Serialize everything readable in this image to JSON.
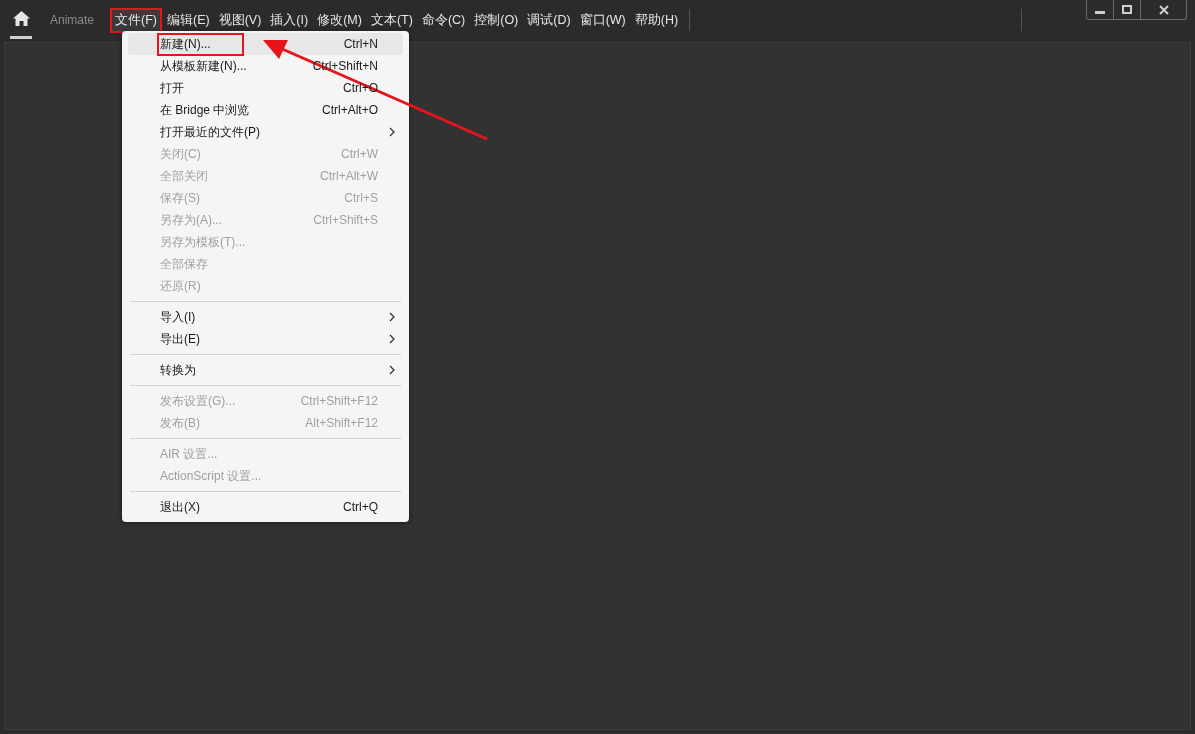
{
  "app": {
    "name": "Animate",
    "home_selected": true
  },
  "menu_bar": [
    {
      "label": "文件(F)",
      "selected": true,
      "marked": true
    },
    {
      "label": "编辑(E)",
      "selected": false,
      "marked": false
    },
    {
      "label": "视图(V)",
      "selected": false,
      "marked": false
    },
    {
      "label": "插入(I)",
      "selected": false,
      "marked": false
    },
    {
      "label": "修改(M)",
      "selected": false,
      "marked": false
    },
    {
      "label": "文本(T)",
      "selected": false,
      "marked": false
    },
    {
      "label": "命令(C)",
      "selected": false,
      "marked": false
    },
    {
      "label": "控制(O)",
      "selected": false,
      "marked": false
    },
    {
      "label": "调试(D)",
      "selected": false,
      "marked": false
    },
    {
      "label": "窗口(W)",
      "selected": false,
      "marked": false
    },
    {
      "label": "帮助(H)",
      "selected": false,
      "marked": false
    }
  ],
  "file_menu": [
    {
      "kind": "item",
      "label": "新建(N)...",
      "shortcut": "Ctrl+N",
      "disabled": false,
      "submenu": false,
      "selected": true,
      "marked": true
    },
    {
      "kind": "item",
      "label": "从模板新建(N)...",
      "shortcut": "Ctrl+Shift+N",
      "disabled": false,
      "submenu": false,
      "selected": false,
      "marked": false
    },
    {
      "kind": "item",
      "label": "打开",
      "shortcut": "Ctrl+O",
      "disabled": false,
      "submenu": false,
      "selected": false,
      "marked": false
    },
    {
      "kind": "item",
      "label": "在 Bridge 中浏览",
      "shortcut": "Ctrl+Alt+O",
      "disabled": false,
      "submenu": false,
      "selected": false,
      "marked": false
    },
    {
      "kind": "item",
      "label": "打开最近的文件(P)",
      "disabled": false,
      "submenu": true,
      "selected": false,
      "marked": false
    },
    {
      "kind": "item",
      "label": "关闭(C)",
      "shortcut": "Ctrl+W",
      "disabled": true,
      "submenu": false,
      "selected": false,
      "marked": false
    },
    {
      "kind": "item",
      "label": "全部关闭",
      "shortcut": "Ctrl+Alt+W",
      "disabled": true,
      "submenu": false,
      "selected": false,
      "marked": false
    },
    {
      "kind": "item",
      "label": "保存(S)",
      "shortcut": "Ctrl+S",
      "disabled": true,
      "submenu": false,
      "selected": false,
      "marked": false
    },
    {
      "kind": "item",
      "label": "另存为(A)...",
      "shortcut": "Ctrl+Shift+S",
      "disabled": true,
      "submenu": false,
      "selected": false,
      "marked": false
    },
    {
      "kind": "item",
      "label": "另存为模板(T)...",
      "disabled": true,
      "submenu": false,
      "selected": false,
      "marked": false
    },
    {
      "kind": "item",
      "label": "全部保存",
      "disabled": true,
      "submenu": false,
      "selected": false,
      "marked": false
    },
    {
      "kind": "item",
      "label": "还原(R)",
      "disabled": true,
      "submenu": false,
      "selected": false,
      "marked": false
    },
    {
      "kind": "separator"
    },
    {
      "kind": "item",
      "label": "导入(I)",
      "disabled": false,
      "submenu": true,
      "selected": false,
      "marked": false
    },
    {
      "kind": "item",
      "label": "导出(E)",
      "disabled": false,
      "submenu": true,
      "selected": false,
      "marked": false
    },
    {
      "kind": "separator"
    },
    {
      "kind": "item",
      "label": "转换为",
      "disabled": false,
      "submenu": true,
      "selected": false,
      "marked": false
    },
    {
      "kind": "separator"
    },
    {
      "kind": "item",
      "label": "发布设置(G)...",
      "shortcut": "Ctrl+Shift+F12",
      "disabled": true,
      "submenu": false,
      "selected": false,
      "marked": false
    },
    {
      "kind": "item",
      "label": "发布(B)",
      "shortcut": "Alt+Shift+F12",
      "disabled": true,
      "submenu": false,
      "selected": false,
      "marked": false
    },
    {
      "kind": "separator"
    },
    {
      "kind": "item",
      "label": "AIR 设置...",
      "disabled": true,
      "submenu": false,
      "selected": false,
      "marked": false
    },
    {
      "kind": "item",
      "label": "ActionScript 设置...",
      "disabled": true,
      "submenu": false,
      "selected": false,
      "marked": false
    },
    {
      "kind": "separator"
    },
    {
      "kind": "item",
      "label": "退出(X)",
      "shortcut": "Ctrl+Q",
      "disabled": false,
      "submenu": false,
      "selected": false,
      "marked": false
    }
  ],
  "pointer_arrow": true
}
